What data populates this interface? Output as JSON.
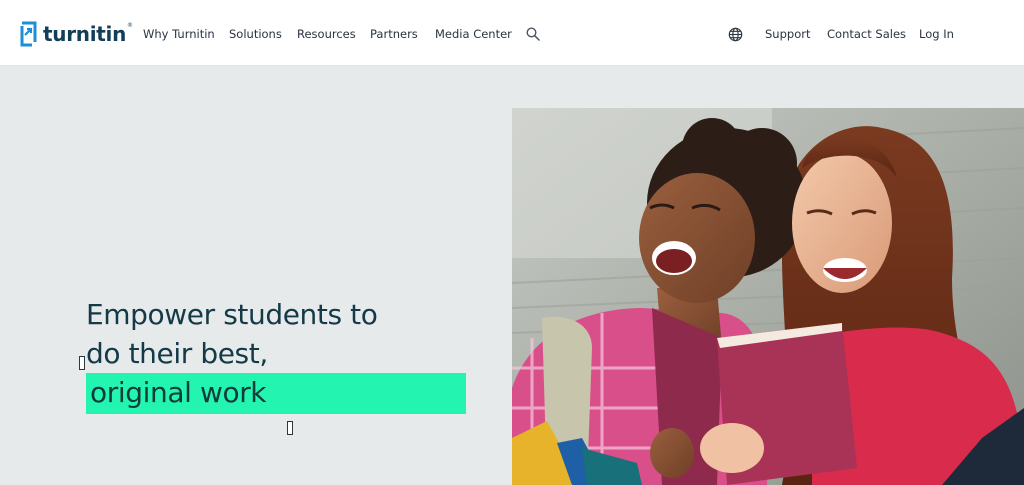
{
  "header": {
    "logo_text": "turnitin",
    "logo_tm": "®",
    "nav": [
      {
        "label": "Why Turnitin"
      },
      {
        "label": "Solutions"
      },
      {
        "label": "Resources"
      },
      {
        "label": "Partners"
      },
      {
        "label": "Media Center"
      }
    ],
    "right_nav": [
      {
        "label": "Support"
      },
      {
        "label": "Contact Sales"
      },
      {
        "label": "Log In"
      }
    ],
    "icons": {
      "search": "search-icon",
      "language": "globe-icon"
    }
  },
  "hero": {
    "line1": "Empower students to",
    "line2": "do their best,",
    "highlight": "original work",
    "image": "students-reading-book-photo"
  },
  "colors": {
    "brand_navy": "#133e57",
    "brand_blue": "#1e8fd6",
    "highlight_green": "#23f5b0",
    "page_bg": "#e6eaeb"
  }
}
